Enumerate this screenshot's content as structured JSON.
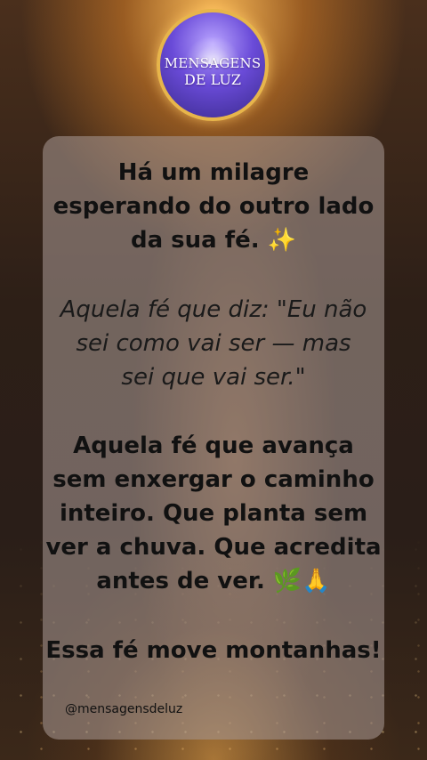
{
  "logo": {
    "line1": "MENSAGENS",
    "line2": "DE LUZ"
  },
  "post": {
    "heading": [
      "Há um milagre",
      "esperando do outro lado",
      "da sua fé. ✨"
    ],
    "quote": [
      "Aquela fé que diz: \"Eu não",
      "sei como vai ser — mas",
      "sei que vai ser.\""
    ],
    "body": [
      "Aquela fé que avança",
      "sem enxergar o caminho",
      "inteiro. Que planta sem",
      "ver a chuva. Que acredita",
      "antes de ver. 🌿🙏"
    ],
    "closing": "Essa fé move montanhas!",
    "handle": "@mensagensdeluz"
  },
  "colors": {
    "logo_border": "#e7b54b",
    "logo_fill": "#6a4bd8",
    "card_bg": "rgba(165,150,145,0.58)",
    "text": "#111111"
  }
}
